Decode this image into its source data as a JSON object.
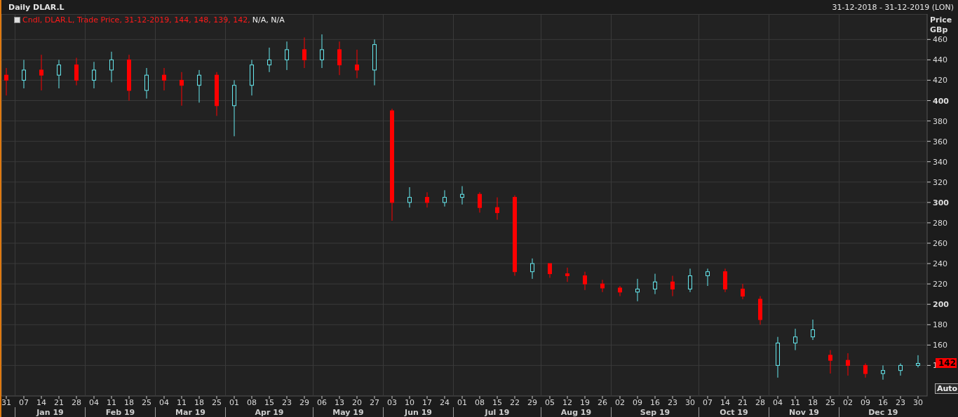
{
  "title": "Daily DLAR.L",
  "date_range": "31-12-2018 - 31-12-2019 (LON)",
  "legend": {
    "text": "Cndl, DLAR.L, Trade Price, 31-12-2019, 144, 148, 139, 142,",
    "extra": "N/A, N/A"
  },
  "axis_title": [
    "Price",
    "GBp"
  ],
  "last_price": "142",
  "auto_button": "Auto",
  "chart_data": {
    "type": "candlestick",
    "grid": true,
    "ylim": [
      110,
      485
    ],
    "yticks": [
      140,
      160,
      180,
      200,
      220,
      240,
      260,
      280,
      300,
      320,
      340,
      360,
      380,
      400,
      420,
      440,
      460
    ],
    "categories": [
      "31",
      "07",
      "14",
      "21",
      "28",
      "04",
      "11",
      "18",
      "25",
      "04",
      "11",
      "18",
      "25",
      "01",
      "08",
      "15",
      "23",
      "29",
      "06",
      "13",
      "20",
      "27",
      "03",
      "10",
      "17",
      "24",
      "01",
      "08",
      "15",
      "22",
      "29",
      "05",
      "12",
      "19",
      "26",
      "02",
      "09",
      "16",
      "23",
      "30",
      "07",
      "14",
      "21",
      "28",
      "04",
      "11",
      "18",
      "25",
      "02",
      "09",
      "16",
      "23",
      "30"
    ],
    "annotations": [
      "Jan 19",
      "Feb 19",
      "Mar 19",
      "Apr 19",
      "May 19",
      "Jun 19",
      "Jul 19",
      "Aug 19",
      "Sep 19",
      "Oct 19",
      "Nov 19",
      "Dec 19"
    ],
    "ohlc": [
      [
        425,
        432,
        405,
        420
      ],
      [
        420,
        440,
        412,
        430
      ],
      [
        430,
        445,
        410,
        425
      ],
      [
        425,
        440,
        412,
        435
      ],
      [
        435,
        442,
        415,
        420
      ],
      [
        420,
        438,
        412,
        430
      ],
      [
        430,
        448,
        418,
        440
      ],
      [
        440,
        445,
        400,
        410
      ],
      [
        410,
        432,
        402,
        425
      ],
      [
        425,
        432,
        410,
        420
      ],
      [
        420,
        428,
        395,
        415
      ],
      [
        415,
        430,
        398,
        425
      ],
      [
        425,
        428,
        385,
        395
      ],
      [
        395,
        420,
        365,
        415
      ],
      [
        415,
        440,
        405,
        435
      ],
      [
        435,
        452,
        428,
        440
      ],
      [
        440,
        458,
        430,
        450
      ],
      [
        450,
        462,
        432,
        440
      ],
      [
        440,
        465,
        432,
        450
      ],
      [
        450,
        458,
        425,
        435
      ],
      [
        435,
        450,
        422,
        430
      ],
      [
        430,
        460,
        415,
        455
      ],
      [
        390,
        392,
        282,
        300
      ],
      [
        300,
        315,
        295,
        305
      ],
      [
        305,
        310,
        295,
        300
      ],
      [
        300,
        312,
        296,
        305
      ],
      [
        305,
        316,
        298,
        308
      ],
      [
        308,
        310,
        290,
        295
      ],
      [
        295,
        305,
        283,
        290
      ],
      [
        305,
        307,
        228,
        232
      ],
      [
        232,
        245,
        225,
        240
      ],
      [
        240,
        240,
        226,
        230
      ],
      [
        230,
        236,
        222,
        228
      ],
      [
        228,
        232,
        214,
        220
      ],
      [
        220,
        224,
        212,
        216
      ],
      [
        216,
        218,
        208,
        212
      ],
      [
        212,
        225,
        203,
        215
      ],
      [
        215,
        230,
        210,
        222
      ],
      [
        222,
        228,
        208,
        215
      ],
      [
        215,
        235,
        212,
        228
      ],
      [
        228,
        235,
        218,
        232
      ],
      [
        232,
        235,
        212,
        215
      ],
      [
        215,
        220,
        205,
        208
      ],
      [
        205,
        208,
        180,
        185
      ],
      [
        140,
        168,
        128,
        162
      ],
      [
        162,
        176,
        155,
        168
      ],
      [
        168,
        185,
        165,
        175
      ],
      [
        150,
        155,
        132,
        145
      ],
      [
        145,
        152,
        130,
        140
      ],
      [
        140,
        142,
        128,
        132
      ],
      [
        132,
        140,
        126,
        135
      ],
      [
        135,
        142,
        130,
        140
      ],
      [
        140,
        150,
        138,
        142
      ]
    ]
  }
}
